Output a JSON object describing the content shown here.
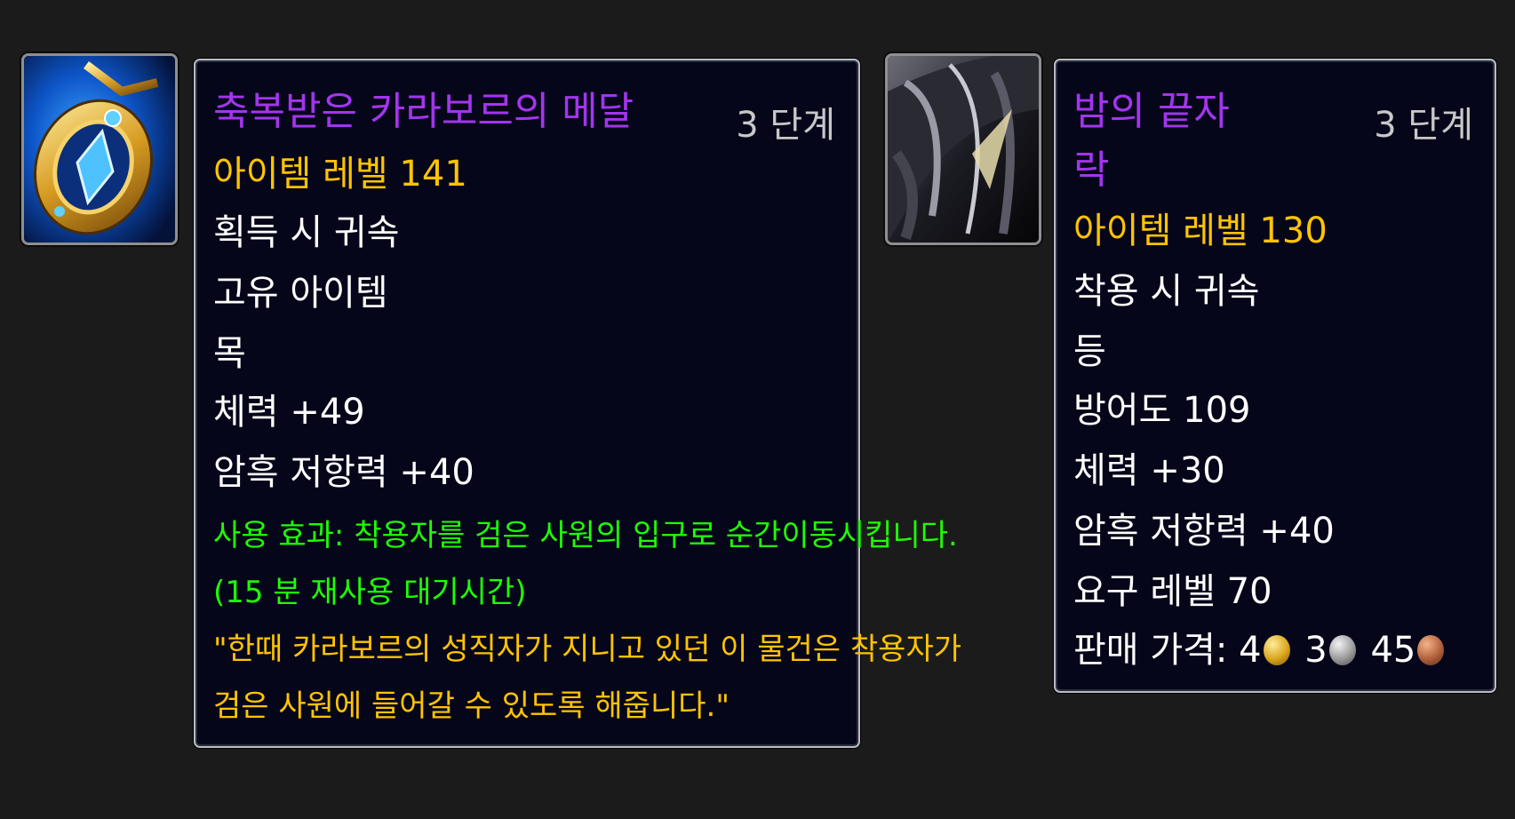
{
  "item1": {
    "icon": "blessed-medal-icon",
    "name": "축복받은 카라보르의 메달",
    "tier": "3 단계",
    "item_level": "아이템 레벨 141",
    "bind": "획득 시 귀속",
    "unique": "고유 아이템",
    "slot": "목",
    "stat_stamina": "체력 +49",
    "stat_shadow_resist": "암흑 저항력 +40",
    "use_effect_line1": "사용 효과: 착용자를 검은 사원의 입구로 순간이동시킵니다.",
    "use_effect_line2": "(15 분 재사용 대기시간)",
    "flavor_line1": "\"한때 카라보르의 성직자가 지니고 있던 이 물건은 착용자가",
    "flavor_line2": "검은 사원에 들어갈 수 있도록 해줍니다.\""
  },
  "item2": {
    "icon": "dark-cloak-icon",
    "name_line1": "밤의 끝자",
    "name_line2": "락",
    "tier": "3 단계",
    "item_level": "아이템 레벨 130",
    "bind": "착용 시 귀속",
    "slot": "등",
    "armor": "방어도 109",
    "stat_stamina": "체력 +30",
    "stat_shadow_resist": "암흑 저항력 +40",
    "req_level": "요구 레벨 70",
    "sell_label": "판매 가격:",
    "price_gold": "4",
    "price_silver": "3",
    "price_copper": "45"
  },
  "colors": {
    "epic_name": "#a335ee",
    "item_level": "#ffc400",
    "use_effect": "#1eff00",
    "flavor": "#ffc400",
    "tooltip_bg": "#06061a"
  }
}
